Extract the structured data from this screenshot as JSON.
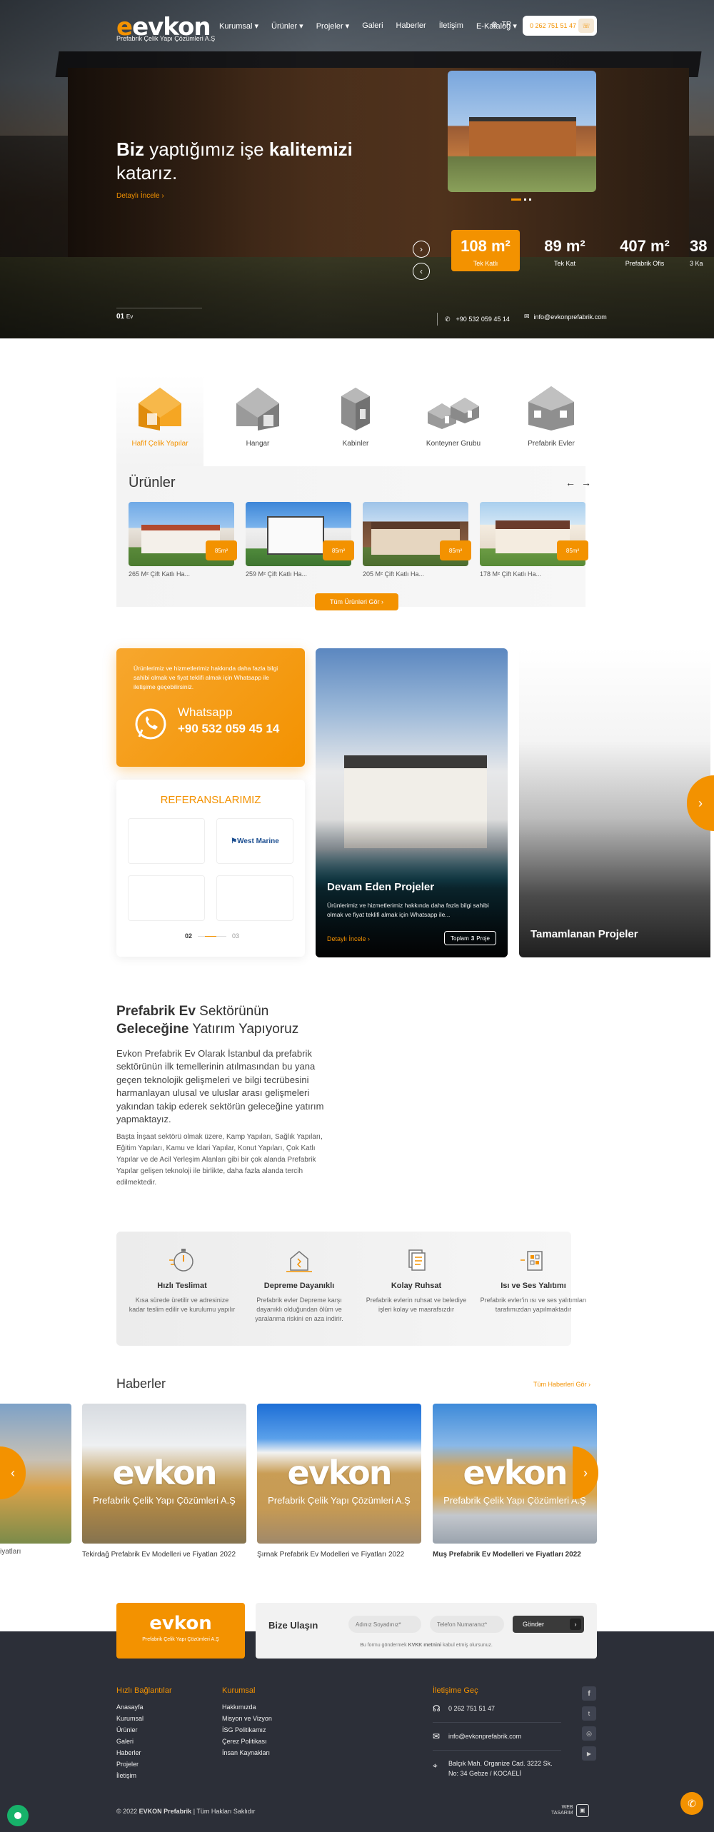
{
  "header": {
    "logo_text": "evkon",
    "logo_sub": "Prefabrik Çelik Yapı Çözümleri A.Ş",
    "nav": [
      "Kurumsal",
      "Ürünler",
      "Projeler",
      "Galeri",
      "Haberler",
      "İletişim",
      "E-Katalog"
    ],
    "lang": "TR",
    "phone": "0 262 751 51 47"
  },
  "hero": {
    "headline_1": "Biz",
    "headline_2": " yaptığımız işe ",
    "headline_3": "kalitemizi",
    "headline_4": "katarız.",
    "cta": "Detaylı İncele",
    "slide_num": "01",
    "slide_label": "Ev",
    "whatsapp": "+90 532 059 45 14",
    "email": "info@evkonprefabrik.com",
    "stats": [
      {
        "value": "108 m²",
        "label": "Tek Katlı"
      },
      {
        "value": "89 m²",
        "label": "Tek Kat"
      },
      {
        "value": "407 m²",
        "label": "Prefabrik Ofis"
      },
      {
        "value": "38",
        "label": "3 Ka"
      }
    ]
  },
  "categories": [
    {
      "label": "Hafif Çelik Yapılar",
      "active": true
    },
    {
      "label": "Hangar",
      "active": false
    },
    {
      "label": "Kabinler",
      "active": false
    },
    {
      "label": "Konteyner Grubu",
      "active": false
    },
    {
      "label": "Prefabrik Evler",
      "active": false
    }
  ],
  "products": {
    "title": "Ürünler",
    "all_button": "Tüm Ürünleri Gör",
    "items": [
      {
        "name": "265 M² Çift Katlı Ha...",
        "badge": "85m²"
      },
      {
        "name": "259 M² Çift Katlı Ha...",
        "badge": "85m²"
      },
      {
        "name": "205 M² Çift Katlı Ha...",
        "badge": "85m²"
      },
      {
        "name": "178 M² Çift Katlı Ha...",
        "badge": "85m²"
      }
    ]
  },
  "contact_box": {
    "text": "Ürünlerimiz ve hizmetlerimiz hakkında daha fazla bilgi sahibi olmak ve fiyat teklifi almak için Whatsapp ile iletişime geçebilirsiniz.",
    "label": "Whatsapp",
    "number": "+90 532 059 45 14"
  },
  "references": {
    "title": "REFERANSLARIMIZ",
    "logo": "West Marine",
    "page_current": "02",
    "page_total": "03"
  },
  "projects": {
    "ongoing_title": "Devam Eden Projeler",
    "ongoing_text": "Ürünlerimiz ve hizmetlerimiz hakkında daha fazla bilgi sahibi olmak ve fiyat teklifi almak için Whatsapp ile...",
    "ongoing_cta": "Detaylı İncele",
    "ongoing_count_label": "Toplam",
    "ongoing_count": "3",
    "ongoing_count_suffix": "Proje",
    "completed_title": "Tamamlanan Projeler"
  },
  "about": {
    "title_1": "Prefabrik Ev",
    "title_2": " Sektörünün",
    "title_3": "Geleceğine",
    "title_4": " Yatırım Yapıyoruz",
    "para_1": "Evkon Prefabrik Ev Olarak İstanbul da prefabrik sektörünün ilk temellerinin atılmasından bu yana geçen teknolojik gelişmeleri ve bilgi tecrübesini harmanlayan ulusal ve uluslar arası gelişmeleri yakından takip ederek sektörün geleceğine yatırım yapmaktayız.",
    "para_2": "Başta İnşaat sektörü olmak üzere, Kamp Yapıları, Sağlık Yapıları, Eğitim Yapıları, Kamu ve İdari Yapılar, Konut Yapıları, Çok Katlı Yapılar ve de Acil Yerleşim Alanları gibi bir çok alanda Prefabrik Yapılar gelişen teknoloji ile birlikte, daha fazla alanda tercih edilmektedir."
  },
  "features": [
    {
      "title": "Hızlı Teslimat",
      "text": "Kısa sürede üretilir ve adresinize kadar teslim edilir ve kurulumu yapılır",
      "icon": "stopwatch-icon"
    },
    {
      "title": "Depreme Dayanıklı",
      "text": "Prefabrik evler Depreme karşı dayanıklı olduğundan ölüm ve yaralanma riskini en aza indirir.",
      "icon": "earthquake-house-icon"
    },
    {
      "title": "Kolay Ruhsat",
      "text": "Prefabrik evlerin ruhsat ve belediye işleri kolay ve masrafsızdır",
      "icon": "documents-icon"
    },
    {
      "title": "Isı ve Ses Yalıtımı",
      "text": "Prefabrik evler'in ısı ve ses yalıtımları tarafımızdan yapılmaktadır",
      "icon": "insulation-icon"
    }
  ],
  "news": {
    "title": "Haberler",
    "all_link": "Tüm Haberleri Gör",
    "partial_title": "iyatları",
    "items": [
      {
        "title": "Tekirdağ Prefabrik Ev Modelleri ve Fiyatları 2022"
      },
      {
        "title": "Şırnak Prefabrik Ev Modelleri ve Fiyatları 2022"
      },
      {
        "title": "Muş Prefabrik Ev Modelleri ve Fiyatları 2022"
      }
    ],
    "card_logo": "evkon",
    "card_sub": "Prefabrik Çelik Yapı Çözümleri A.Ş"
  },
  "contact_form": {
    "title": "Bize Ulaşın",
    "name_placeholder": "Adınız Soyadınız*",
    "phone_placeholder": "Telefon Numaranız*",
    "submit": "Gönder",
    "note_1": "Bu formu göndermek ",
    "note_bold": "KVKK metnini",
    "note_2": " kabul etmiş olursunuz."
  },
  "footer": {
    "quick_title": "Hızlı Bağlantılar",
    "quick_links": [
      "Anasayfa",
      "Kurumsal",
      "Ürünler",
      "Galeri",
      "Haberler",
      "Projeler",
      "İletişim"
    ],
    "corp_title": "Kurumsal",
    "corp_links": [
      "Hakkımızda",
      "Misyon ve Vizyon",
      "İSG Politikamız",
      "Çerez Politikası",
      "İnsan Kaynakları"
    ],
    "contact_title": "İletişime Geç",
    "phone": "0 262 751 51 47",
    "email": "info@evkonprefabrik.com",
    "address": "Balçık Mah. Organize Cad. 3222 Sk. No: 34 Gebze / KOCAELİ",
    "copyright_1": "© 2022 ",
    "copyright_bold": "EVKON Prefabrik",
    "copyright_2": " | Tüm Hakları Saklıdır",
    "agency_1": "WEB",
    "agency_2": "TASARIM"
  },
  "colors": {
    "accent": "#f39200",
    "dark_footer": "#2c2f38"
  }
}
